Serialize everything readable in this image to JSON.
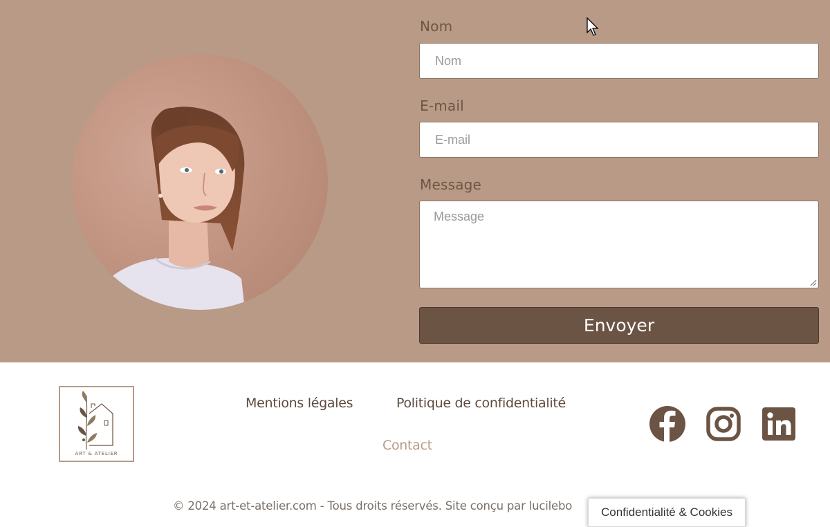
{
  "contact_form": {
    "name_label": "Nom",
    "name_placeholder": "Nom",
    "email_label": "E-mail",
    "email_placeholder": "E-mail",
    "message_label": "Message",
    "message_placeholder": "Message",
    "submit_label": "Envoyer"
  },
  "footer": {
    "logo_text": "ART & ATELIER",
    "links": {
      "legal": "Mentions légales",
      "privacy": "Politique de confidentialité",
      "contact": "Contact"
    },
    "social": [
      "facebook-icon",
      "instagram-icon",
      "linkedin-icon"
    ],
    "copyright": "© 2024 art-et-atelier.com - Tous droits réservés. Site conçu par lucilebo",
    "cookie_button": "Confidentialité & Cookies"
  },
  "colors": {
    "section_background": "#b89a86",
    "button_background": "#6b5444",
    "icon_color": "#6b5444",
    "footer_background": "#ffffff"
  }
}
